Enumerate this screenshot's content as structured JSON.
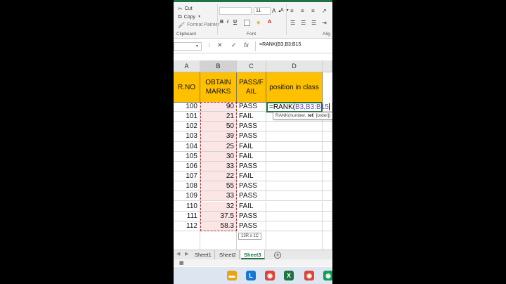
{
  "ribbon": {
    "clipboard": {
      "cut": "Cut",
      "copy": "Copy",
      "format_painter": "Format Painter",
      "group_label": "Clipboard"
    },
    "font": {
      "size": "11",
      "group_label": "Font",
      "bold": "B",
      "italic": "I",
      "underline": "U"
    },
    "alignment_label": "Alig"
  },
  "formula_bar": {
    "name_box": "",
    "cancel_icon": "✕",
    "enter_icon": "✓",
    "fx_label": "fx",
    "formula": "=RANK(B3,B3:B15"
  },
  "columns": [
    "A",
    "B",
    "C",
    "D"
  ],
  "header_row": [
    "R.NO",
    "OBTAIN MARKS",
    "PASS/FAIL",
    "position in class"
  ],
  "rows": [
    {
      "rno": "100",
      "marks": "90",
      "status": "PASS"
    },
    {
      "rno": "101",
      "marks": "21",
      "status": "FAIL"
    },
    {
      "rno": "102",
      "marks": "50",
      "status": "PASS"
    },
    {
      "rno": "103",
      "marks": "39",
      "status": "PASS"
    },
    {
      "rno": "104",
      "marks": "25",
      "status": "FAIL"
    },
    {
      "rno": "105",
      "marks": "30",
      "status": "FAIL"
    },
    {
      "rno": "106",
      "marks": "33",
      "status": "PASS"
    },
    {
      "rno": "107",
      "marks": "22",
      "status": "FAIL"
    },
    {
      "rno": "108",
      "marks": "55",
      "status": "PASS"
    },
    {
      "rno": "109",
      "marks": "33",
      "status": "PASS"
    },
    {
      "rno": "110",
      "marks": "32",
      "status": "FAIL"
    },
    {
      "rno": "111",
      "marks": "37.5",
      "status": "PASS"
    },
    {
      "rno": "112",
      "marks": "58.3",
      "status": "PASS"
    }
  ],
  "active_cell": {
    "prefix": "=RANK(",
    "ref": "B3,B3:B15"
  },
  "tooltip": {
    "fn": "RANK(number, ",
    "ref": "ref",
    "rest": ", [order])"
  },
  "selection_size": "13R x 1C",
  "sheets": [
    "Sheet1",
    "Sheet2",
    "Sheet3"
  ],
  "active_sheet": "Sheet3",
  "taskbar": [
    {
      "name": "file-explorer-icon",
      "glyph": "▬",
      "color": "#e8a317"
    },
    {
      "name": "app-l-icon",
      "glyph": "L",
      "color": "#1976d2"
    },
    {
      "name": "chrome-icon",
      "glyph": "◉",
      "color": "#db4437"
    },
    {
      "name": "excel-icon",
      "glyph": "X",
      "color": "#1f7244"
    },
    {
      "name": "chrome-icon-2",
      "glyph": "◉",
      "color": "#db4437"
    },
    {
      "name": "chrome-icon-3",
      "glyph": "◉",
      "color": "#0f9d58"
    }
  ],
  "colors": {
    "header_fill": "#ffc000",
    "excel_green": "#217346",
    "selection_fill": "#fbe5e5"
  }
}
